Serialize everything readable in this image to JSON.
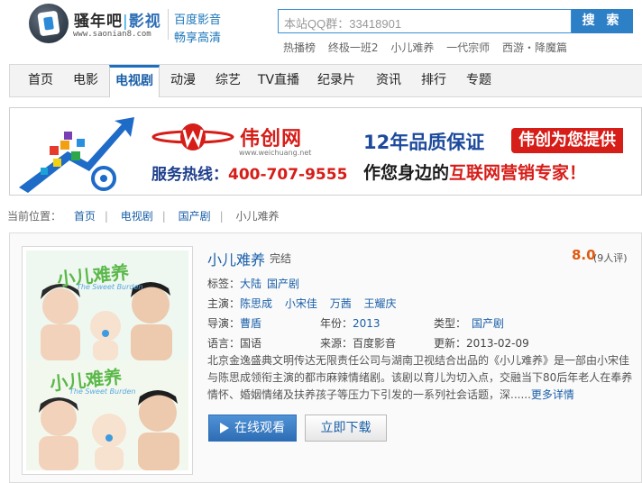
{
  "header": {
    "brand_name": "骚年吧",
    "brand_sep": "|",
    "brand_sub": "影视",
    "brand_url": "www.saonian8.com",
    "slogan_line1": "百度影音",
    "slogan_line2": "畅享高清"
  },
  "search": {
    "value": "本站QQ群：33418901",
    "button_label": "搜 索",
    "hot_links": [
      "热播榜",
      "终极一班2",
      "小儿难养",
      "一代宗师",
      "西游・降魔篇"
    ]
  },
  "nav": {
    "items": [
      {
        "label": "首页"
      },
      {
        "label": "电影"
      },
      {
        "label": "电视剧",
        "active": true
      },
      {
        "label": "动漫"
      },
      {
        "label": "综艺"
      },
      {
        "label": "TV直播"
      },
      {
        "label": "纪录片"
      },
      {
        "label": "资讯"
      },
      {
        "label": "排行"
      },
      {
        "label": "专题"
      }
    ]
  },
  "banner": {
    "company_name": "伟创网",
    "company_url": "www.weichuang.net",
    "hotline_label": "服务热线：",
    "hotline_number": "400-707-9555",
    "quality": "12年品质保证",
    "slogan_tag": "伟创为您提供",
    "expert_prefix": "作您身边的",
    "expert_highlight": "互联网营销专家！",
    "colors": {
      "red": "#d61d18",
      "blue": "#1d4a9c"
    }
  },
  "breadcrumb": {
    "label": "当前位置：",
    "items": [
      "首页",
      "电视剧",
      "国产剧"
    ],
    "current": "小儿难养"
  },
  "detail": {
    "title": "小儿难养",
    "status": "完结",
    "score": "8.0",
    "score_count": "(9人评)",
    "tags_label": "标签：",
    "tags": [
      "大陆",
      "国产剧"
    ],
    "cast_label": "主演：",
    "cast": [
      "陈思成",
      "小宋佳",
      "万茜",
      "王耀庆"
    ],
    "director_label": "导演：",
    "director": "曹盾",
    "year_label": "年份：",
    "year": "2013",
    "type_label": "类型：",
    "type": "国产剧",
    "language_label": "语言：",
    "language": "国语",
    "source_label": "来源：",
    "source": "百度影音",
    "updated_label": "更新：",
    "updated": "2013-02-09",
    "synopsis": "北京金逸盛典文明传达无限责任公司与湖南卫视结合出品的《小儿难养》是一部由小宋佳与陈思成领衔主演的都市麻辣情绪剧。该剧以育儿为切入点，交融当下80后年老人在奉养情怀、婚姻情绪及扶养孩子等压力下引发的一系列社会话题，深......",
    "more_label": "更多详情",
    "poster_title": "小儿难养",
    "poster_subtitle": "The Sweet Burden"
  },
  "actions": {
    "watch_label": "在线观看",
    "download_label": "立即下载"
  }
}
